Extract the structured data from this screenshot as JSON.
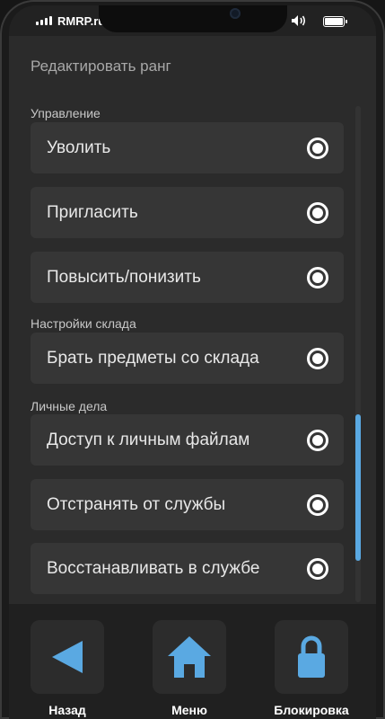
{
  "status_bar": {
    "carrier": "RMRP.ru",
    "signal_icon": "signal-bars-icon",
    "volume_icon": "speaker-icon",
    "battery_icon": "battery-icon"
  },
  "page": {
    "title": "Редактировать ранг"
  },
  "sections": [
    {
      "label": "Управление",
      "items": [
        {
          "label": "Уволить",
          "checked": true
        },
        {
          "label": "Пригласить",
          "checked": true
        },
        {
          "label": "Повысить/понизить",
          "checked": true
        }
      ]
    },
    {
      "label": "Настройки склада",
      "items": [
        {
          "label": "Брать предметы со склада",
          "checked": true
        }
      ]
    },
    {
      "label": "Личные дела",
      "items": [
        {
          "label": "Доступ к личным файлам",
          "checked": true
        },
        {
          "label": "Отстранять от службы",
          "checked": true
        },
        {
          "label": "Восстанавливать в службе",
          "checked": true
        }
      ]
    }
  ],
  "bottom_nav": [
    {
      "label": "Назад",
      "icon": "back-arrow-icon"
    },
    {
      "label": "Меню",
      "icon": "home-icon"
    },
    {
      "label": "Блокировка",
      "icon": "lock-icon"
    }
  ],
  "colors": {
    "accent": "#5aa9e2",
    "background": "#2b2b2b",
    "row": "#363636"
  }
}
